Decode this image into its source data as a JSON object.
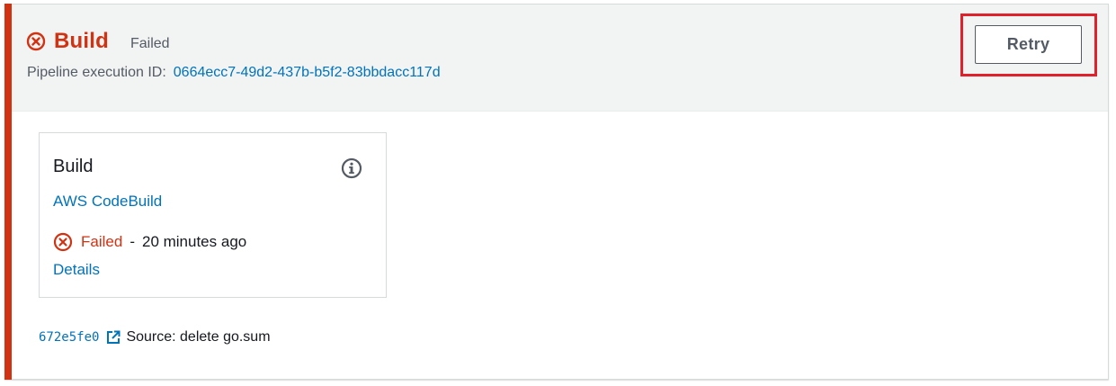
{
  "colors": {
    "error": "#d13212",
    "link": "#0073bb",
    "muted": "#545b64",
    "header_bg": "#f2f3f3",
    "highlight": "#e0202a"
  },
  "stage": {
    "status_icon": "error-circle-icon",
    "title": "Build",
    "status": "Failed",
    "execution_label": "Pipeline execution ID:",
    "execution_id": "0664ecc7-49d2-437b-b5f2-83bbdacc117d",
    "retry_label": "Retry"
  },
  "action": {
    "name": "Build",
    "info_icon": "info-icon",
    "provider": "AWS CodeBuild",
    "status_icon": "error-circle-icon",
    "status": "Failed",
    "separator": "-",
    "time": "20 minutes ago",
    "details_label": "Details"
  },
  "source": {
    "commit_id": "672e5fe0",
    "external_icon": "external-link-icon",
    "message": "Source: delete go.sum"
  }
}
